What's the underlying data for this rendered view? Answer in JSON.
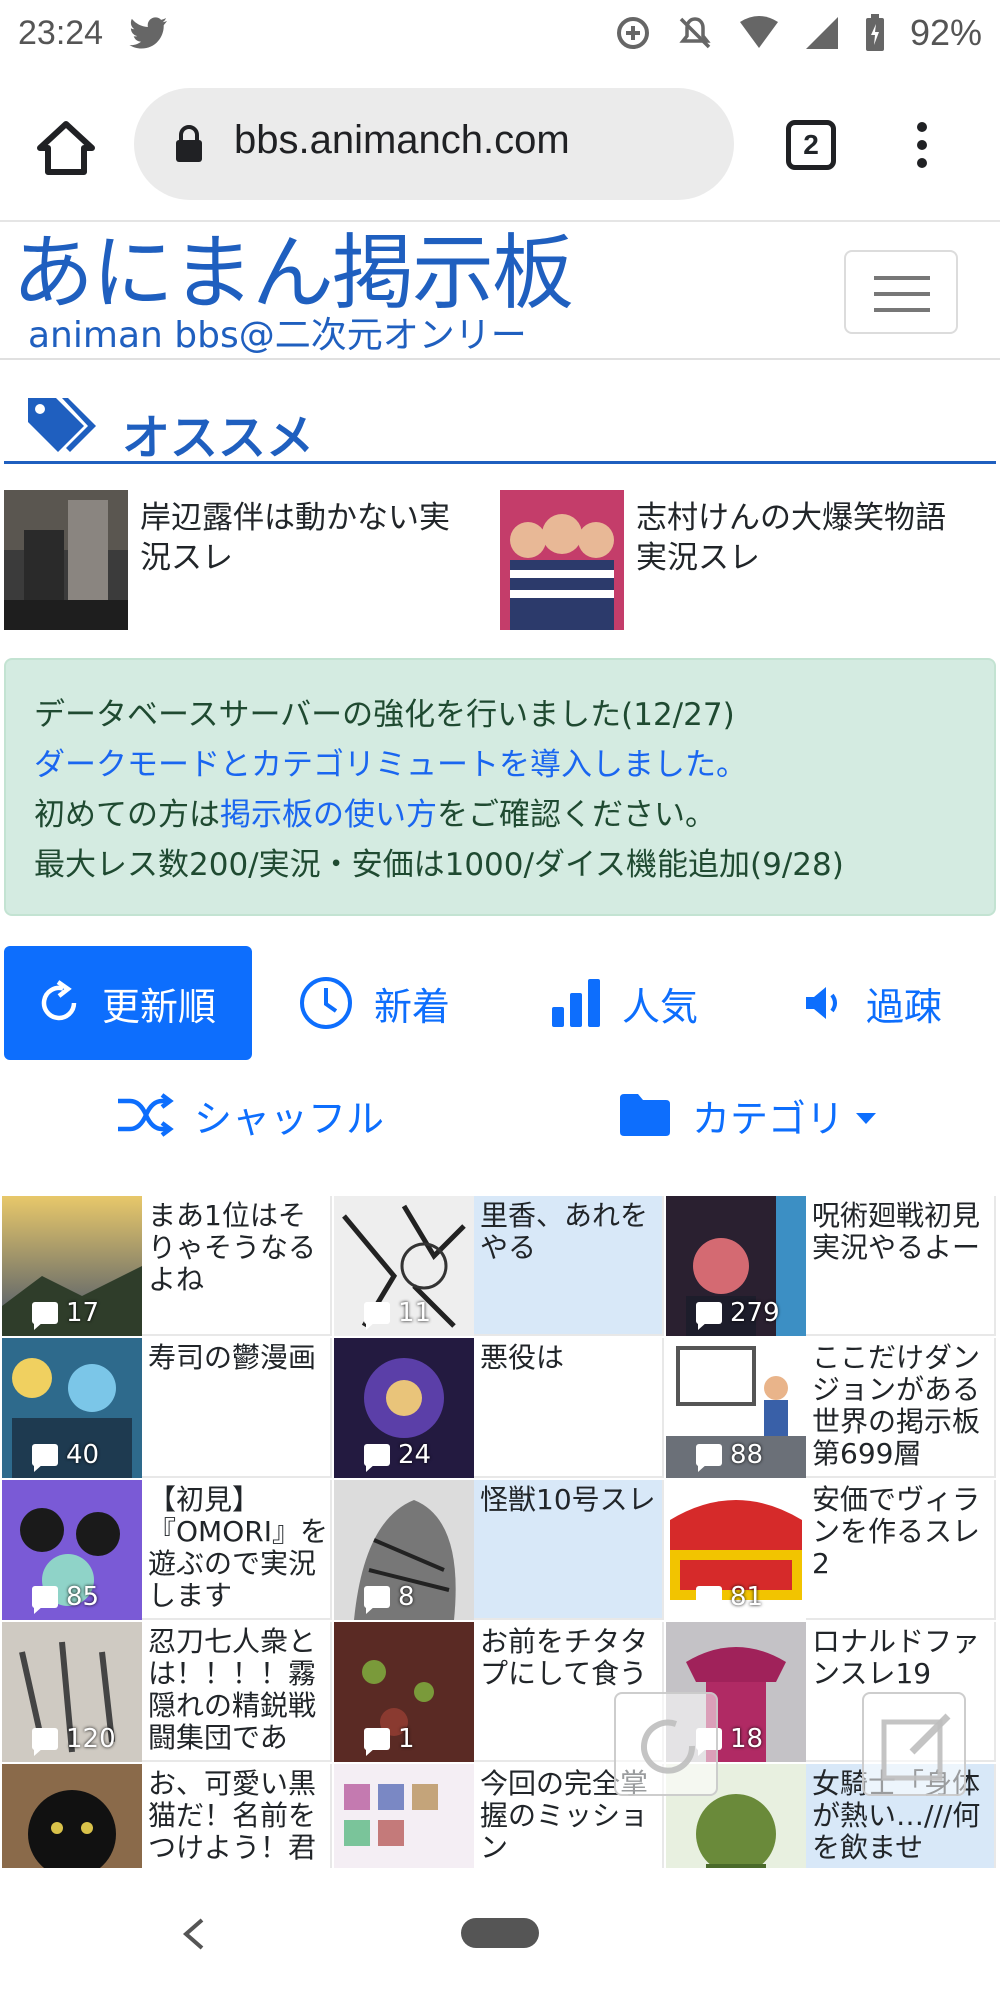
{
  "status_bar": {
    "time": "23:24",
    "battery": "92%"
  },
  "browser": {
    "url": "bbs.animanch.com",
    "tab_count": "2"
  },
  "site": {
    "logo_main": "あにまん掲示板",
    "logo_sub": "animan bbs@二次元オンリー"
  },
  "recommended": {
    "heading": "オススメ",
    "items": [
      {
        "title": "岸辺露伴は動かない実況スレ"
      },
      {
        "title": "志村けんの大爆笑物語実況スレ"
      }
    ]
  },
  "notice": {
    "line1": "データベースサーバーの強化を行いました(12/27)",
    "line2": "ダークモードとカテゴリミュートを導入しました。",
    "line3_pre": "初めての方は",
    "line3_link": "掲示板の使い方",
    "line3_post": "をご確認ください。",
    "line4": "最大レス数200/実況・安価は1000/ダイス機能追加(9/28)"
  },
  "sort_tabs": {
    "updated": "更新順",
    "new": "新着",
    "popular": "人気",
    "stale": "過疎",
    "shuffle": "シャッフル",
    "category": "カテゴリ"
  },
  "threads": [
    {
      "title": "まあ1位はそりゃそうなるよね",
      "count": "17"
    },
    {
      "title": "里香、あれをやる",
      "count": "11"
    },
    {
      "title": "呪術廻戦初見実況やるよー",
      "count": "279"
    },
    {
      "title": "寿司の鬱漫画",
      "count": "40"
    },
    {
      "title": "悪役は",
      "count": "24"
    },
    {
      "title": "ここだけダンジョンがある世界の掲示板第699層",
      "count": "88"
    },
    {
      "title": "【初見】『OMORI』を遊ぶので実況します",
      "count": "85"
    },
    {
      "title": "怪獣10号スレ",
      "count": "8"
    },
    {
      "title": "安価でヴィランを作るスレ2",
      "count": "81"
    },
    {
      "title": "忍刀七人衆とは！！！！霧隠れの精鋭戦闘集団であ",
      "count": "120"
    },
    {
      "title": "お前をチタタプにして食う",
      "count": "1"
    },
    {
      "title": "ロナルドファンスレ19",
      "count": "18"
    },
    {
      "title": "お、可愛い黒猫だ！名前をつけよう！君",
      "count": ""
    },
    {
      "title": "今回の完全掌握のミッション",
      "count": ""
    },
    {
      "title": "女騎士「身体が熱い…///何を飲ませ",
      "count": ""
    }
  ],
  "colors": {
    "brand": "#1f5fbf",
    "primary": "#0d6efd",
    "notice_bg": "#d4ebe1",
    "highlight": "#d8e8f8"
  }
}
